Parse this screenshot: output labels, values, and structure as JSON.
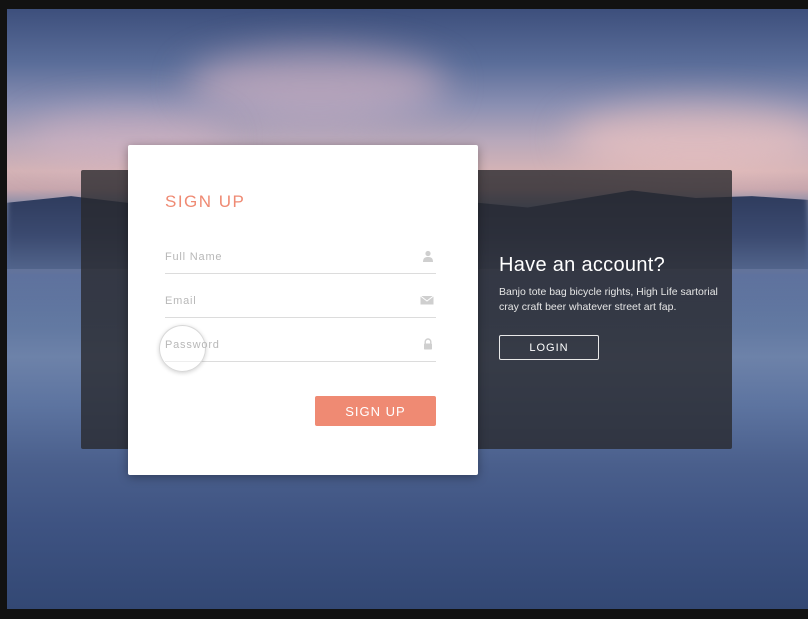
{
  "info": {
    "title": "Have an account?",
    "text": "Banjo tote bag bicycle rights, High Life sartorial cray craft beer whatever street art fap.",
    "login_label": "LOGIN"
  },
  "signup": {
    "title": "SIGN UP",
    "fields": [
      {
        "placeholder": "Full Name",
        "icon": "user-icon"
      },
      {
        "placeholder": "Email",
        "icon": "envelope-icon"
      },
      {
        "placeholder": "Password",
        "icon": "lock-icon"
      }
    ],
    "button_label": "SIGN UP"
  },
  "colors": {
    "accent": "#ef8a73",
    "panel": "#28282c",
    "card": "#ffffff"
  }
}
